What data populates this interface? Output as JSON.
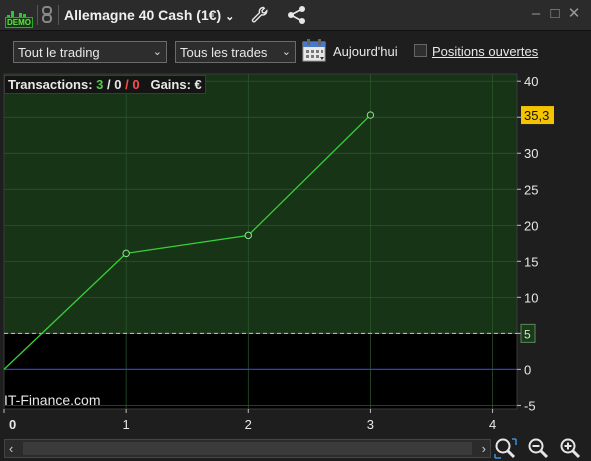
{
  "titlebar": {
    "demo_label": "DEMO",
    "instrument": "Allemagne 40 Cash (1€)",
    "icons": [
      "link-icon",
      "wrench-icon",
      "share-icon",
      "minimize-icon",
      "restore-icon",
      "close-icon"
    ]
  },
  "toolbar": {
    "filter_select": "Tout le trading",
    "trades_select": "Tous les trades",
    "today_label": "Aujourd'hui",
    "positions_label": "Positions ouvertes",
    "positions_checked": false
  },
  "info": {
    "transactions_label": "Transactions:",
    "wins": "3",
    "neutral": "0",
    "losses": "0",
    "sep": "/",
    "gains_label": "Gains:",
    "currency": "€"
  },
  "watermark": "IT-Finance.com",
  "colors": {
    "positive_fill": "#173417",
    "line": "#38d038",
    "negative_fill": "#000000",
    "zero_line": "#2f3fd0",
    "last_value_bg": "#f5c400"
  },
  "chart_data": {
    "type": "line",
    "x": [
      0,
      1,
      2,
      3
    ],
    "y": [
      0,
      16.1,
      18.6,
      35.3
    ],
    "xlim": [
      0,
      4.2
    ],
    "ylim": [
      -5.5,
      41
    ],
    "x_ticks": [
      "0",
      "1",
      "2",
      "3",
      "4"
    ],
    "y_ticks": [
      "40",
      "35",
      "30",
      "25",
      "20",
      "15",
      "10",
      "5",
      "0",
      "-5"
    ],
    "y_tick_values": [
      40,
      35,
      30,
      25,
      20,
      15,
      10,
      5,
      0,
      -5
    ],
    "last_value_label": "35,3",
    "threshold_value": 5,
    "threshold_label": "5",
    "grid": true
  }
}
